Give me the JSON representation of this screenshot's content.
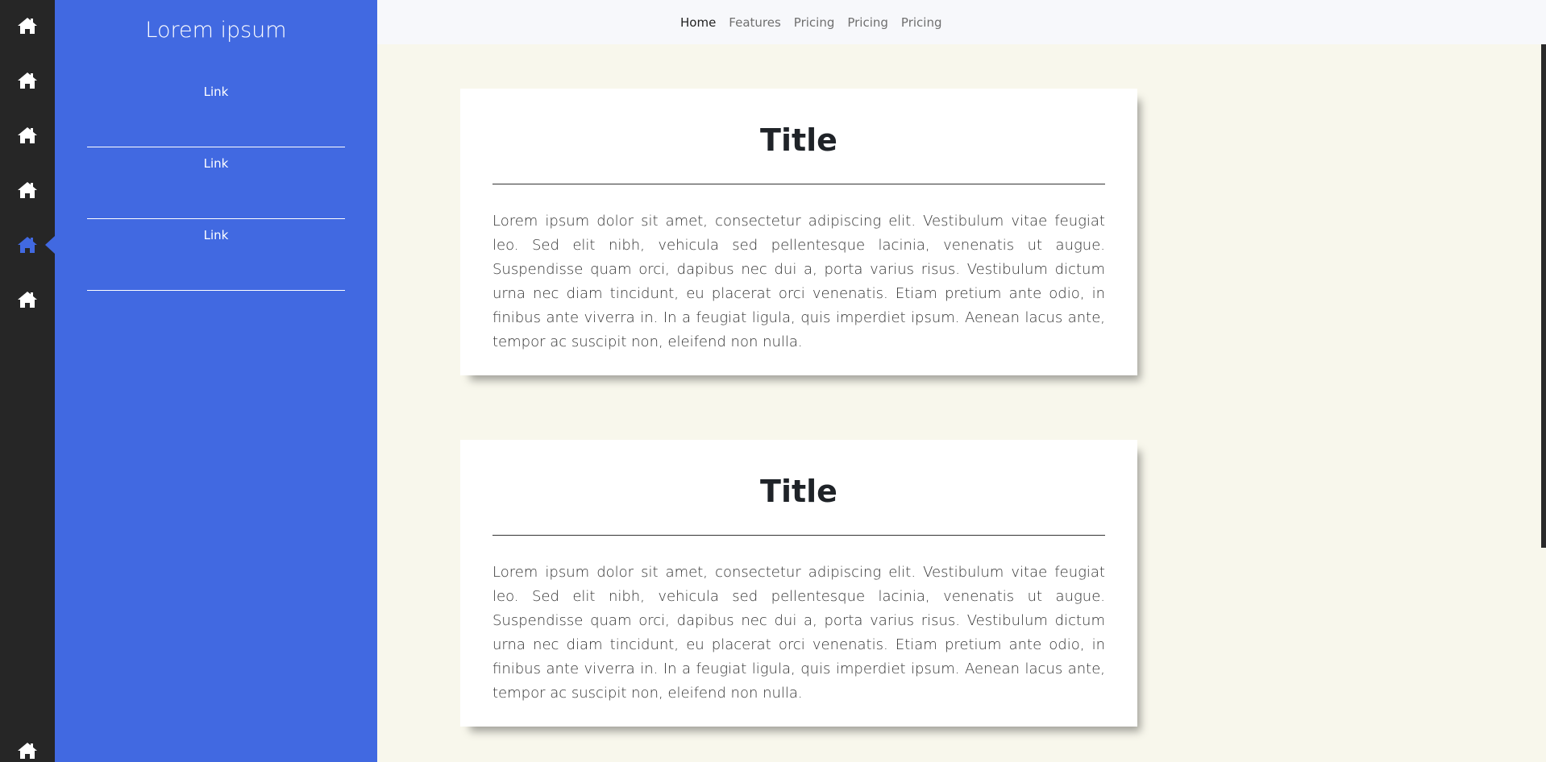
{
  "rail": {
    "icons": [
      "home-icon",
      "home-icon",
      "home-icon",
      "home-icon",
      "home-icon",
      "home-icon",
      "home-icon"
    ],
    "active_index": 4,
    "active_color": "#4169e1"
  },
  "sidebar": {
    "title": "Lorem ipsum",
    "links": [
      {
        "label": "Link"
      },
      {
        "label": "Link"
      },
      {
        "label": "Link"
      }
    ],
    "background": "#4169e1"
  },
  "topnav": {
    "items": [
      {
        "label": "Home",
        "active": true
      },
      {
        "label": "Features",
        "active": false
      },
      {
        "label": "Pricing",
        "active": false
      },
      {
        "label": "Pricing",
        "active": false
      },
      {
        "label": "Pricing",
        "active": false
      }
    ]
  },
  "cards": [
    {
      "title": "Title",
      "body": "Lorem ipsum dolor sit amet, consectetur adipiscing elit. Vestibulum vitae feugiat leo. Sed elit nibh, vehicula sed pellentesque lacinia, venenatis ut augue. Suspendisse quam orci, dapibus nec dui a, porta varius risus. Vestibulum dictum urna nec diam tincidunt, eu placerat orci venenatis. Etiam pretium ante odio, in finibus ante viverra in. In a feugiat ligula, quis imperdiet ipsum. Aenean lacus ante, tempor ac suscipit non, eleifend non nulla."
    },
    {
      "title": "Title",
      "body": "Lorem ipsum dolor sit amet, consectetur adipiscing elit. Vestibulum vitae feugiat leo. Sed elit nibh, vehicula sed pellentesque lacinia, venenatis ut augue. Suspendisse quam orci, dapibus nec dui a, porta varius risus. Vestibulum dictum urna nec diam tincidunt, eu placerat orci venenatis. Etiam pretium ante odio, in finibus ante viverra in. In a feugiat ligula, quis imperdiet ipsum. Aenean lacus ante, tempor ac suscipit non, eleifend non nulla."
    }
  ]
}
